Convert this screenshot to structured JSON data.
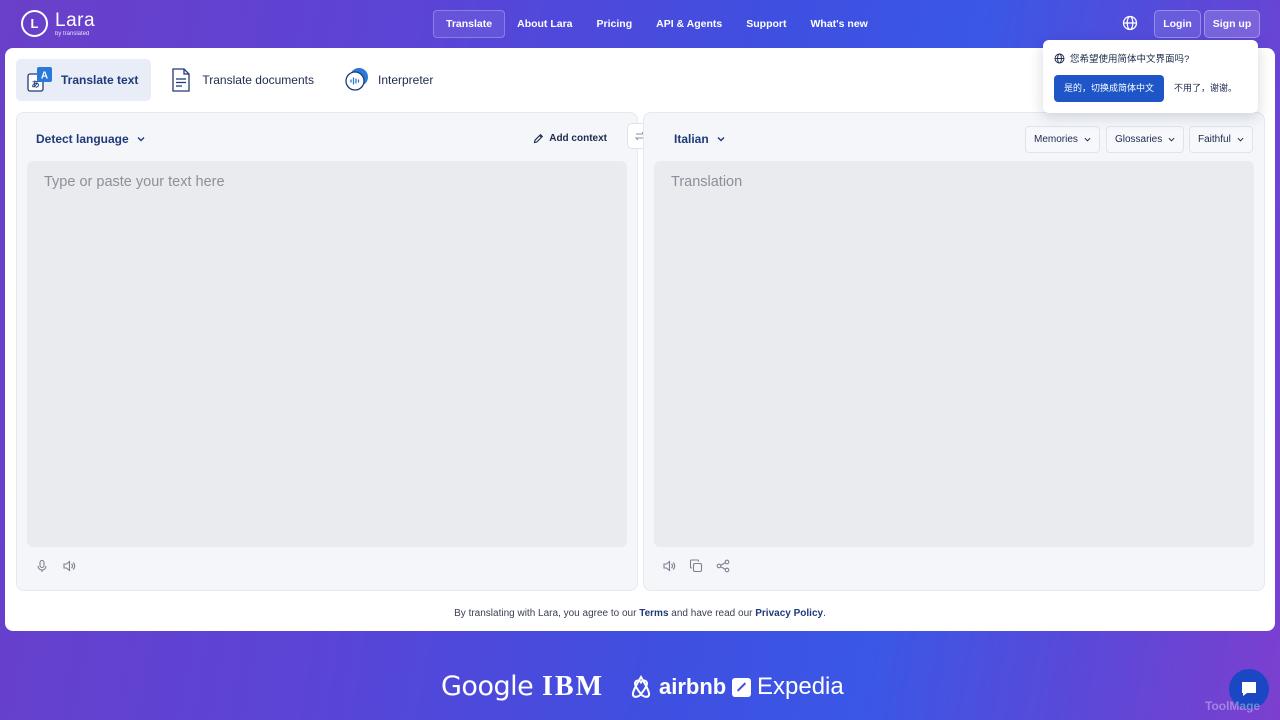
{
  "brand": {
    "name": "Lara",
    "byline": "by translated",
    "logo_letter": "L"
  },
  "nav": {
    "items": [
      {
        "label": "Translate",
        "active": true
      },
      {
        "label": "About Lara",
        "active": false
      },
      {
        "label": "Pricing",
        "active": false
      },
      {
        "label": "API & Agents",
        "active": false
      },
      {
        "label": "Support",
        "active": false
      },
      {
        "label": "What's new",
        "active": false
      }
    ],
    "login": "Login",
    "signup": "Sign up"
  },
  "popup": {
    "question": "您希望使用简体中文界面吗?",
    "accept": "是的，切换成简体中文",
    "decline": "不用了，谢谢。"
  },
  "tabs": [
    {
      "label": "Translate text",
      "icon": "translate-text-icon",
      "active": true
    },
    {
      "label": "Translate documents",
      "icon": "document-icon",
      "active": false
    },
    {
      "label": "Interpreter",
      "icon": "interpreter-icon",
      "active": false
    }
  ],
  "source": {
    "language": "Detect language",
    "add_context": "Add context",
    "placeholder": "Type or paste your text here"
  },
  "target": {
    "language": "Italian",
    "placeholder": "Translation",
    "options": [
      "Memories",
      "Glossaries",
      "Faithful"
    ]
  },
  "terms": {
    "prefix": "By translating with Lara, you agree to our",
    "terms_link": "Terms",
    "middle": "and have read our",
    "privacy_link": "Privacy Policy",
    "suffix": "."
  },
  "partners": [
    "Google",
    "IBM",
    "airbnb",
    "Expedia"
  ],
  "watermark": "ToolMage",
  "colors": {
    "accent": "#1f56c7",
    "brand_dark": "#1f3a7a",
    "gradient_start": "#6a3fc9",
    "gradient_mid": "#3f4fe0"
  }
}
